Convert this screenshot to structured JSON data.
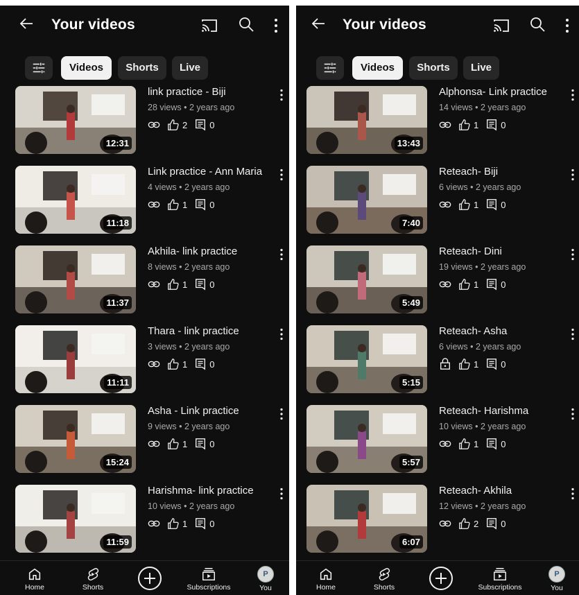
{
  "header": {
    "title": "Your videos"
  },
  "chips": {
    "videos": "Videos",
    "shorts": "Shorts",
    "live": "Live"
  },
  "left_list": [
    {
      "title": "link practice - Biji",
      "meta": "28 views • 2 years ago",
      "likes": "2",
      "comments": "0",
      "duration": "12:31",
      "privacy": "link"
    },
    {
      "title": "Link practice - Ann Maria",
      "meta": "4 views • 2 years ago",
      "likes": "1",
      "comments": "0",
      "duration": "11:18",
      "privacy": "link"
    },
    {
      "title": "Akhila- link practice",
      "meta": "8 views • 2 years ago",
      "likes": "1",
      "comments": "0",
      "duration": "11:37",
      "privacy": "link"
    },
    {
      "title": "Thara - link practice",
      "meta": "3 views • 2 years ago",
      "likes": "1",
      "comments": "0",
      "duration": "11:11",
      "privacy": "link"
    },
    {
      "title": "Asha - Link practice",
      "meta": "9 views • 2 years ago",
      "likes": "1",
      "comments": "0",
      "duration": "15:24",
      "privacy": "link"
    },
    {
      "title": "Harishma- link practice",
      "meta": "10 views • 2 years ago",
      "likes": "1",
      "comments": "0",
      "duration": "11:59",
      "privacy": "link"
    }
  ],
  "right_list": [
    {
      "title": "Alphonsa- Link practice",
      "meta": "14 views • 2 years ago",
      "likes": "1",
      "comments": "0",
      "duration": "13:43",
      "privacy": "link"
    },
    {
      "title": "Reteach- Biji",
      "meta": "6 views • 2 years ago",
      "likes": "1",
      "comments": "0",
      "duration": "7:40",
      "privacy": "link"
    },
    {
      "title": "Reteach- Dini",
      "meta": "19 views • 2 years ago",
      "likes": "1",
      "comments": "0",
      "duration": "5:49",
      "privacy": "link"
    },
    {
      "title": "Reteach- Asha",
      "meta": "6 views • 2 years ago",
      "likes": "1",
      "comments": "0",
      "duration": "5:15",
      "privacy": "lock"
    },
    {
      "title": "Reteach- Harishma",
      "meta": "10 views • 2 years ago",
      "likes": "1",
      "comments": "0",
      "duration": "5:57",
      "privacy": "link"
    },
    {
      "title": "Reteach- Akhila",
      "meta": "12 views • 2 years ago",
      "likes": "2",
      "comments": "0",
      "duration": "6:07",
      "privacy": "link"
    }
  ],
  "nav": {
    "home": "Home",
    "shorts": "Shorts",
    "subscriptions": "Subscriptions",
    "you": "You",
    "avatar_letter": "P"
  },
  "icons": {
    "back": "back-arrow-icon",
    "cast": "cast-icon",
    "search": "search-icon",
    "more": "more-vert-icon",
    "filter": "filter-icon",
    "link": "link-icon",
    "lock": "lock-icon",
    "like": "thumb-up-icon",
    "comment": "comment-icon",
    "create": "create-plus-icon",
    "subscriptions": "subscriptions-icon",
    "home": "home-icon",
    "shorts": "shorts-icon"
  }
}
